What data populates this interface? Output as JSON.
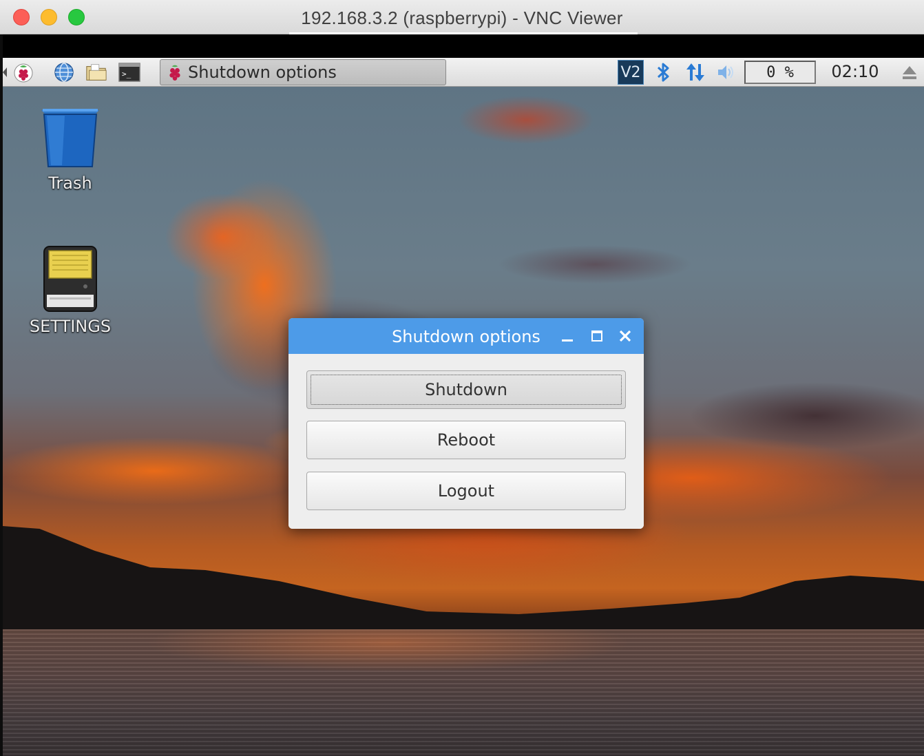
{
  "window": {
    "title": "192.168.3.2 (raspberrypi) - VNC Viewer"
  },
  "panel": {
    "launchers": [
      "raspberry-menu-icon",
      "web-browser-icon",
      "file-manager-icon",
      "terminal-icon"
    ],
    "task_label": "Shutdown options",
    "vnc_label": "V2",
    "cpu_usage": "0 %",
    "clock": "02:10"
  },
  "desktop": {
    "icons": [
      {
        "label": "Trash",
        "icon": "trash-icon"
      },
      {
        "label": "SETTINGS",
        "icon": "sd-card-icon"
      }
    ]
  },
  "dialog": {
    "title": "Shutdown options",
    "buttons": {
      "shutdown": "Shutdown",
      "reboot": "Reboot",
      "logout": "Logout"
    },
    "focused": "shutdown"
  },
  "colors": {
    "dialog_titlebar": "#4d9be8",
    "panel_background": "#e6e6e6",
    "mac_close": "#fc5f57",
    "mac_minimize": "#fdbc2e",
    "mac_zoom": "#28c840"
  }
}
